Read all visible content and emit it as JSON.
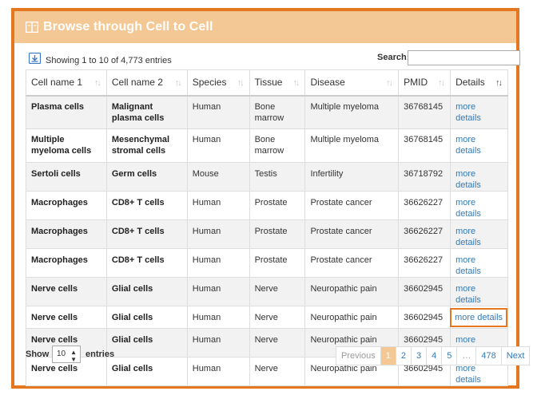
{
  "header": {
    "title": "Browse through Cell to Cell"
  },
  "toolbar": {
    "info": "Showing 1 to 10 of 4,773 entries",
    "search_label": "Search:",
    "search_value": ""
  },
  "table": {
    "columns": [
      "Cell name 1",
      "Cell name 2",
      "Species",
      "Tissue",
      "Disease",
      "PMID",
      "Details"
    ],
    "rows": [
      [
        "Plasma cells",
        "Malignant plasma cells",
        "Human",
        "Bone marrow",
        "Multiple myeloma",
        "36768145",
        "more details"
      ],
      [
        "Multiple myeloma cells",
        "Mesenchymal stromal cells",
        "Human",
        "Bone marrow",
        "Multiple myeloma",
        "36768145",
        "more details"
      ],
      [
        "Sertoli cells",
        "Germ cells",
        "Mouse",
        "Testis",
        "Infertility",
        "36718792",
        "more details"
      ],
      [
        "Macrophages",
        "CD8+ T cells",
        "Human",
        "Prostate",
        "Prostate cancer",
        "36626227",
        "more details"
      ],
      [
        "Macrophages",
        "CD8+ T cells",
        "Human",
        "Prostate",
        "Prostate cancer",
        "36626227",
        "more details"
      ],
      [
        "Macrophages",
        "CD8+ T cells",
        "Human",
        "Prostate",
        "Prostate cancer",
        "36626227",
        "more details"
      ],
      [
        "Nerve cells",
        "Glial cells",
        "Human",
        "Nerve",
        "Neuropathic pain",
        "36602945",
        "more details"
      ],
      [
        "Nerve cells",
        "Glial cells",
        "Human",
        "Nerve",
        "Neuropathic pain",
        "36602945",
        "more details"
      ],
      [
        "Nerve cells",
        "Glial cells",
        "Human",
        "Nerve",
        "Neuropathic pain",
        "36602945",
        "more details"
      ],
      [
        "Nerve cells",
        "Glial cells",
        "Human",
        "Nerve",
        "Neuropathic pain",
        "36602945",
        "more details"
      ]
    ]
  },
  "footer": {
    "show_label": "Show",
    "page_length": "10",
    "entries_label": "entries",
    "pagination": [
      "Previous",
      "1",
      "2",
      "3",
      "4",
      "5",
      "…",
      "478",
      "Next"
    ],
    "current_page": "1"
  },
  "colors": {
    "accent": "#e4771f",
    "header_bg": "#f4c894",
    "link": "#337ab7"
  },
  "icons": {
    "header": "book-icon",
    "toolbar": "download-icon",
    "sort": "sort-icon",
    "select": "chevron-updown-icon"
  }
}
